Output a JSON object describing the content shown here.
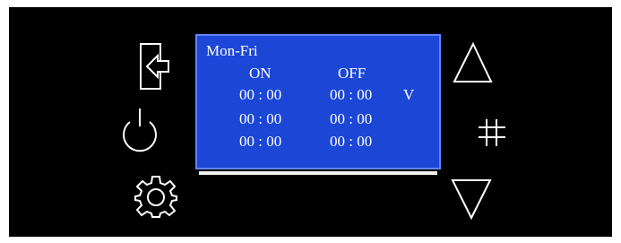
{
  "colors": {
    "background": "#000000",
    "screen": "#1c47d6",
    "screen_border": "#5f86ff",
    "text": "#ffffff"
  },
  "icons": {
    "left": [
      "back-icon",
      "power-icon",
      "settings-icon"
    ],
    "right": [
      "up-arrow-icon",
      "hash-icon",
      "down-arrow-icon"
    ]
  },
  "screen": {
    "title": "Mon-Fri",
    "col_on": "ON",
    "col_off": "OFF",
    "rows": [
      {
        "on": "00 : 00",
        "off": "00 : 00",
        "marker": "V"
      },
      {
        "on": "00 : 00",
        "off": "00 : 00",
        "marker": ""
      },
      {
        "on": "00 : 00",
        "off": "00 : 00",
        "marker": ""
      }
    ]
  }
}
